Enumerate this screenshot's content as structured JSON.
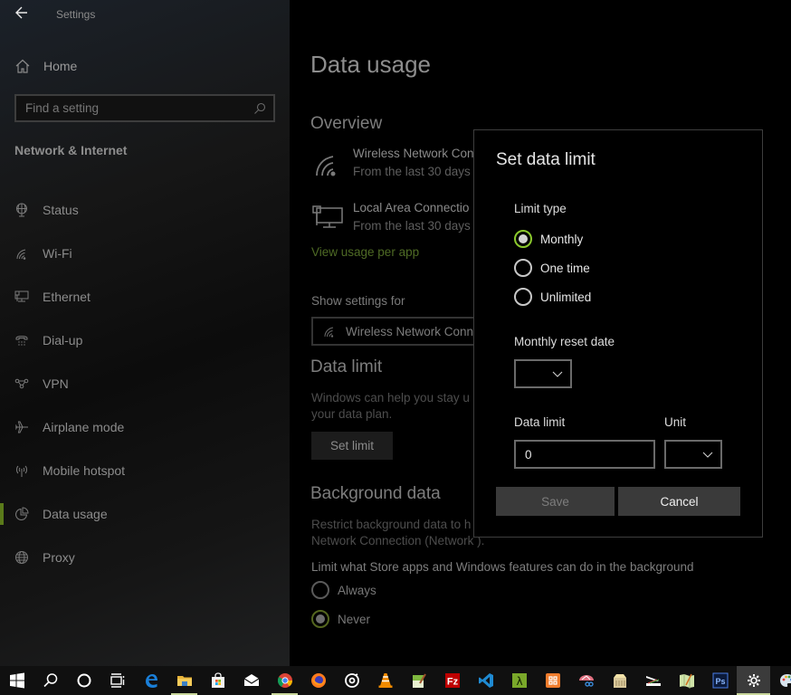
{
  "app": {
    "title": "Settings"
  },
  "sidebar": {
    "home_label": "Home",
    "search_placeholder": "Find a setting",
    "section_title": "Network & Internet",
    "items": [
      {
        "label": "Status",
        "icon": "status-globe-icon"
      },
      {
        "label": "Wi-Fi",
        "icon": "wifi-icon"
      },
      {
        "label": "Ethernet",
        "icon": "ethernet-icon"
      },
      {
        "label": "Dial-up",
        "icon": "dialup-phone-icon"
      },
      {
        "label": "VPN",
        "icon": "vpn-icon"
      },
      {
        "label": "Airplane mode",
        "icon": "airplane-icon"
      },
      {
        "label": "Mobile hotspot",
        "icon": "hotspot-icon"
      },
      {
        "label": "Data usage",
        "icon": "data-usage-pie-icon",
        "active": true
      },
      {
        "label": "Proxy",
        "icon": "proxy-globe-icon"
      }
    ],
    "accent_color": "#5a7a1a"
  },
  "main": {
    "title": "Data usage",
    "overview": {
      "heading": "Overview",
      "items": [
        {
          "name": "Wireless Network Con",
          "sub": "From the last 30 days",
          "icon": "wifi-icon"
        },
        {
          "name": "Local Area Connectio",
          "sub": "From the last 30 days",
          "icon": "ethernet-icon"
        }
      ],
      "link": "View usage per app"
    },
    "show_settings": {
      "label": "Show settings for",
      "value": "Wireless Network Conn"
    },
    "data_limit": {
      "heading": "Data limit",
      "description_line1": "Windows can help you stay u",
      "description_line2": "your data plan.",
      "button": "Set limit"
    },
    "background_data": {
      "heading": "Background data",
      "description_line1": "Restrict background data to h",
      "description_line2": "Network Connection (Network ).",
      "limit_label": "Limit what Store apps and Windows features can do in the background",
      "options": [
        {
          "label": "Always",
          "selected": false
        },
        {
          "label": "Never",
          "selected": true
        }
      ]
    }
  },
  "dialog": {
    "title": "Set data limit",
    "limit_type_label": "Limit type",
    "limit_types": [
      {
        "label": "Monthly",
        "selected": true
      },
      {
        "label": "One time",
        "selected": false
      },
      {
        "label": "Unlimited",
        "selected": false
      }
    ],
    "reset_date_label": "Monthly reset date",
    "reset_date_value": "",
    "data_limit_label": "Data limit",
    "data_limit_value": "0",
    "unit_label": "Unit",
    "unit_value": "",
    "save_label": "Save",
    "cancel_label": "Cancel",
    "accent_color": "#8bc92d"
  },
  "taskbar": {
    "items": [
      {
        "name": "start",
        "icon": "windows-logo-icon"
      },
      {
        "name": "search",
        "icon": "search-icon"
      },
      {
        "name": "cortana",
        "icon": "cortana-circle-icon"
      },
      {
        "name": "task-view",
        "icon": "task-view-icon"
      },
      {
        "name": "edge",
        "icon": "edge-icon"
      },
      {
        "name": "file-explorer",
        "icon": "folder-icon",
        "running": true
      },
      {
        "name": "store",
        "icon": "store-bag-icon"
      },
      {
        "name": "mail",
        "icon": "mail-icon"
      },
      {
        "name": "chrome",
        "icon": "chrome-icon",
        "running": true
      },
      {
        "name": "firefox",
        "icon": "firefox-icon"
      },
      {
        "name": "groove",
        "icon": "groove-music-icon"
      },
      {
        "name": "vlc",
        "icon": "vlc-cone-icon"
      },
      {
        "name": "notepad",
        "icon": "notepad-icon"
      },
      {
        "name": "filezilla",
        "icon": "filezilla-icon"
      },
      {
        "name": "vscode",
        "icon": "vscode-icon"
      },
      {
        "name": "lambda-app",
        "icon": "lambda-icon"
      },
      {
        "name": "xampp",
        "icon": "xampp-icon"
      },
      {
        "name": "snipping-tool",
        "icon": "snipping-tool-icon"
      },
      {
        "name": "archive",
        "icon": "archive-icon"
      },
      {
        "name": "scanner",
        "icon": "scanner-icon"
      },
      {
        "name": "maps",
        "icon": "maps-icon"
      },
      {
        "name": "photoshop",
        "icon": "photoshop-icon"
      },
      {
        "name": "settings",
        "icon": "gear-icon",
        "active": true
      },
      {
        "name": "paint",
        "icon": "paint-palette-icon"
      }
    ]
  }
}
